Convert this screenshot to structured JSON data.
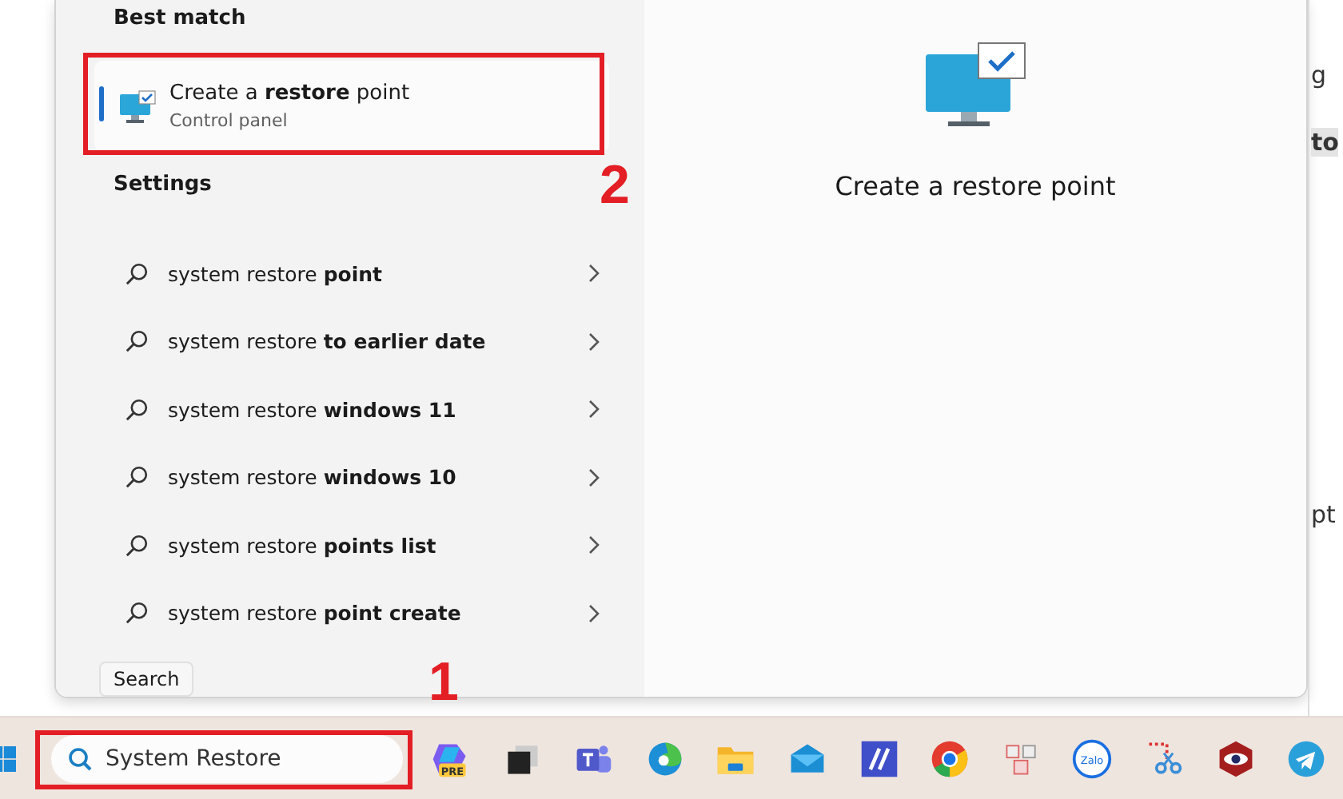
{
  "search_panel": {
    "best_match": {
      "heading": "Best match",
      "title": "Create a **restore** point",
      "subtitle": "Control panel",
      "selected": true
    },
    "settings": {
      "heading": "Settings",
      "items": [
        {
          "label": "system restore **point**"
        },
        {
          "label": "system restore **to earlier date**"
        },
        {
          "label": "system restore **windows 11**"
        },
        {
          "label": "system restore **windows 10**"
        },
        {
          "label": "system restore **points list**"
        },
        {
          "label": "system restore **point create**"
        }
      ]
    },
    "preview": {
      "title": "Create a restore point"
    }
  },
  "background_fragments": [
    "g",
    "to",
    "pt"
  ],
  "tooltip": "Search",
  "taskbar": {
    "search_value": "System Restore",
    "apps": [
      {
        "kind": "copilot",
        "badge": "PRE"
      },
      {
        "kind": "task-view"
      },
      {
        "kind": "teams"
      },
      {
        "kind": "edge"
      },
      {
        "kind": "explorer"
      },
      {
        "kind": "mail"
      },
      {
        "kind": "ai-app"
      },
      {
        "kind": "chrome"
      },
      {
        "kind": "grid-app"
      },
      {
        "kind": "zalo",
        "badge": "Zalo"
      },
      {
        "kind": "snip"
      },
      {
        "kind": "eye-app"
      },
      {
        "kind": "telegram"
      }
    ]
  },
  "step_markers": {
    "best_match": "2",
    "search_field": "1"
  }
}
